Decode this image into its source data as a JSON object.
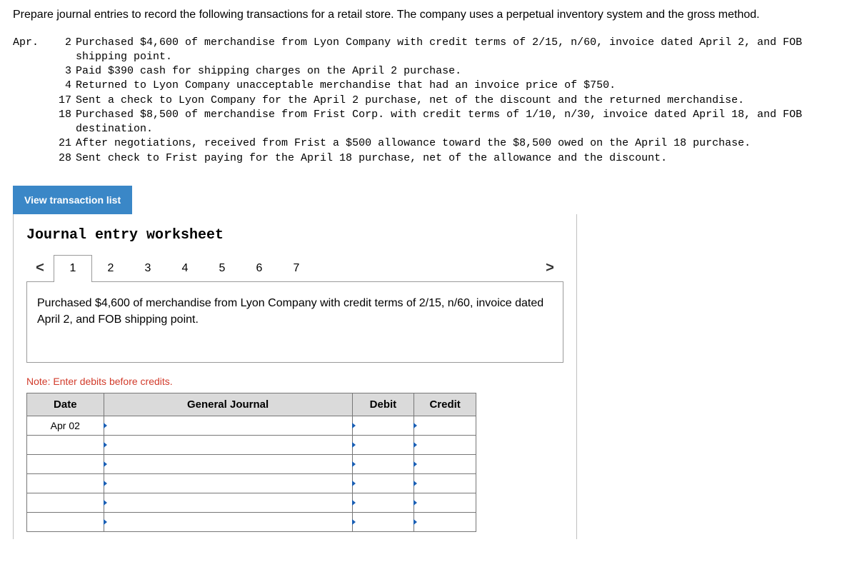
{
  "intro": "Prepare journal entries to record the following transactions for a retail store. The company uses a perpetual inventory system and the gross method.",
  "month_label": "Apr.",
  "transactions": [
    {
      "day": "2",
      "text": "Purchased $4,600 of merchandise from Lyon Company with credit terms of 2/15, n/60, invoice dated April 2, and FOB shipping point."
    },
    {
      "day": "3",
      "text": "Paid $390 cash for shipping charges on the April 2 purchase."
    },
    {
      "day": "4",
      "text": "Returned to Lyon Company unacceptable merchandise that had an invoice price of $750."
    },
    {
      "day": "17",
      "text": "Sent a check to Lyon Company for the April 2 purchase, net of the discount and the returned merchandise."
    },
    {
      "day": "18",
      "text": "Purchased $8,500 of merchandise from Frist Corp. with credit terms of 1/10, n/30, invoice dated April 18, and FOB destination."
    },
    {
      "day": "21",
      "text": "After negotiations, received from Frist a $500 allowance toward the $8,500 owed on the April 18 purchase."
    },
    {
      "day": "28",
      "text": "Sent check to Frist paying for the April 18 purchase, net of the allowance and the discount."
    }
  ],
  "view_btn": "View transaction list",
  "worksheet_title": "Journal entry worksheet",
  "pager": {
    "prev": "<",
    "next": ">",
    "tabs": [
      "1",
      "2",
      "3",
      "4",
      "5",
      "6",
      "7"
    ],
    "active_index": 0
  },
  "current_description": "Purchased $4,600 of merchandise from Lyon Company with credit terms of 2/15, n/60, invoice dated April 2, and FOB shipping point.",
  "note": "Note: Enter debits before credits.",
  "table": {
    "headers": {
      "date": "Date",
      "gj": "General Journal",
      "debit": "Debit",
      "credit": "Credit"
    },
    "rows": [
      {
        "date": "Apr 02",
        "gj": "",
        "debit": "",
        "credit": ""
      },
      {
        "date": "",
        "gj": "",
        "debit": "",
        "credit": ""
      },
      {
        "date": "",
        "gj": "",
        "debit": "",
        "credit": ""
      },
      {
        "date": "",
        "gj": "",
        "debit": "",
        "credit": ""
      },
      {
        "date": "",
        "gj": "",
        "debit": "",
        "credit": ""
      },
      {
        "date": "",
        "gj": "",
        "debit": "",
        "credit": ""
      }
    ]
  }
}
